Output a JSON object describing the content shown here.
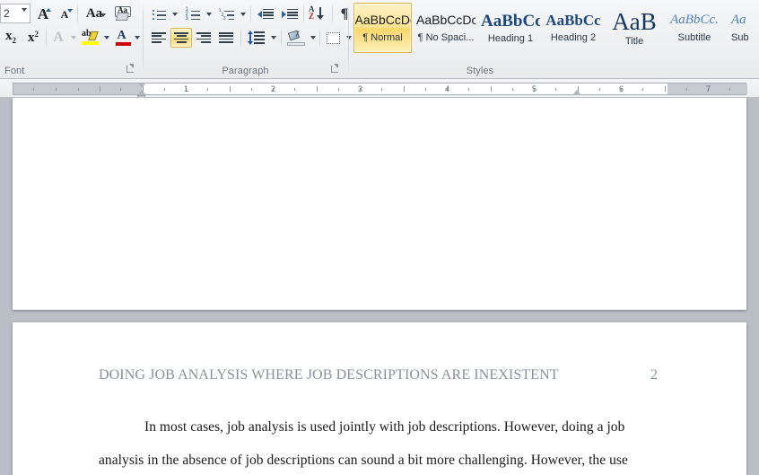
{
  "ribbon": {
    "groups": [
      {
        "id": "font",
        "label": "Font"
      },
      {
        "id": "paragraph",
        "label": "Paragraph"
      },
      {
        "id": "styles",
        "label": "Styles"
      }
    ],
    "font_group": {
      "label": "Font",
      "font_size_value": "2",
      "font_size_caret_icon": "chevron-down-icon",
      "buttons": [
        {
          "name": "grow-font-button",
          "icon": "grow-font-icon",
          "glyph": "A"
        },
        {
          "name": "shrink-font-button",
          "icon": "shrink-font-icon",
          "glyph": "A"
        },
        {
          "name": "change-case-button",
          "icon": "change-case-icon",
          "glyph": "Aa"
        },
        {
          "name": "clear-formatting-button",
          "icon": "clear-formatting-icon",
          "glyph": "Aa"
        },
        {
          "name": "subscript-button",
          "icon": "subscript-icon",
          "glyph": "x"
        },
        {
          "name": "superscript-button",
          "icon": "superscript-icon",
          "glyph": "x"
        },
        {
          "name": "text-effects-button",
          "icon": "text-effects-icon",
          "glyph": "A"
        },
        {
          "name": "text-highlight-color-button",
          "icon": "highlight-icon",
          "glyph": "ab"
        },
        {
          "name": "font-color-button",
          "icon": "font-color-icon",
          "glyph": "A"
        }
      ],
      "dialog_launcher": "font-dialog-launcher"
    },
    "paragraph_group": {
      "label": "Paragraph",
      "buttons": [
        {
          "name": "bullets-button",
          "icon": "bullet-list-icon"
        },
        {
          "name": "numbering-button",
          "icon": "numbered-list-icon"
        },
        {
          "name": "multilevel-list-button",
          "icon": "multilevel-list-icon"
        },
        {
          "name": "decrease-indent-button",
          "icon": "decrease-indent-icon"
        },
        {
          "name": "increase-indent-button",
          "icon": "increase-indent-icon"
        },
        {
          "name": "sort-button",
          "icon": "sort-az-icon"
        },
        {
          "name": "show-formatting-marks-button",
          "icon": "pilcrow-icon",
          "glyph": "¶"
        },
        {
          "name": "align-left-button",
          "icon": "align-left-icon"
        },
        {
          "name": "align-center-button",
          "icon": "align-center-icon",
          "selected": true
        },
        {
          "name": "align-right-button",
          "icon": "align-right-icon"
        },
        {
          "name": "justify-button",
          "icon": "justify-icon"
        },
        {
          "name": "line-spacing-button",
          "icon": "line-spacing-icon"
        },
        {
          "name": "shading-button",
          "icon": "shading-paint-bucket-icon"
        },
        {
          "name": "borders-button",
          "icon": "borders-icon"
        }
      ],
      "dialog_launcher": "paragraph-dialog-launcher"
    },
    "styles_group": {
      "label": "Styles",
      "items": [
        {
          "name": "style-normal",
          "preview": "AaBbCcDc",
          "label": "¶ Normal",
          "selected": true,
          "preview_style": "normal"
        },
        {
          "name": "style-no-spacing",
          "preview": "AaBbCcDc",
          "label": "¶ No Spaci...",
          "selected": false,
          "preview_style": "normal"
        },
        {
          "name": "style-heading-1",
          "preview": "AaBbCс",
          "label": "Heading 1",
          "selected": false,
          "preview_style": "heading1"
        },
        {
          "name": "style-heading-2",
          "preview": "AaBbCc",
          "label": "Heading 2",
          "selected": false,
          "preview_style": "heading2"
        },
        {
          "name": "style-title",
          "preview": "AaB",
          "label": "Title",
          "selected": false,
          "preview_style": "title"
        },
        {
          "name": "style-subtitle",
          "preview": "AaBbCc.",
          "label": "Subtitle",
          "selected": false,
          "preview_style": "subtitle"
        },
        {
          "name": "style-subtle-emphasis",
          "preview": "Aa",
          "label": "Sub",
          "selected": false,
          "preview_style": "subtitle"
        }
      ]
    }
  },
  "ruler": {
    "unit_numbers": [
      "1",
      "2",
      "3",
      "4",
      "5",
      "6",
      "7"
    ],
    "left_margin_end_inch": 1.0,
    "right_margin_start_inch": 6.5,
    "first_line_indent_icon": "first-line-indent-marker",
    "hanging_indent_icon": "hanging-indent-marker",
    "left_indent_icon": "left-indent-marker",
    "right_indent_icon": "right-indent-marker"
  },
  "document": {
    "page1_name": "document-page-1",
    "page2_name": "document-page-2",
    "header_text": "DOING JOB ANALYSIS WHERE JOB DESCRIPTIONS ARE INEXISTENT",
    "header_page_number": "2",
    "body_line_1": "In most cases, job analysis is used jointly with job descriptions. However, doing a job",
    "body_line_2": "analysis in the absence of job descriptions can sound a bit more challenging.  However, the use"
  },
  "colors": {
    "ribbon_bg": "#eef0f2",
    "selection_gold": "#f8d668",
    "heading_blue": "#1f497d",
    "highlight_yellow": "#ffff00",
    "font_color_red": "#cc0000",
    "doc_background": "#babfc5",
    "header_gray": "#8a8f9e"
  }
}
